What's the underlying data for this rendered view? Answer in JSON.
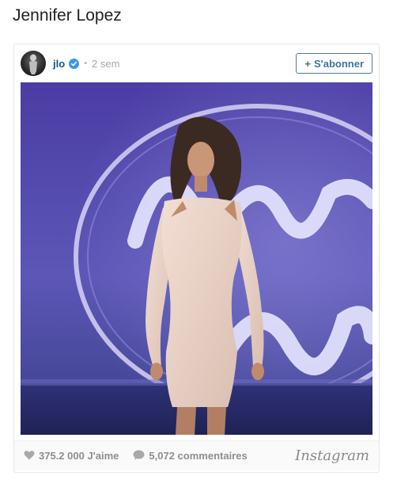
{
  "page": {
    "title": "Jennifer Lopez"
  },
  "post": {
    "username": "jlo",
    "separator": "•",
    "time": "2 sem",
    "follow_label": "S'abonner",
    "follow_plus": "+"
  },
  "footer": {
    "likes": "375.2 000 J'aime",
    "comments": "5,072 commentaires",
    "brand": "Instagram"
  },
  "colors": {
    "username": "#125688",
    "verified": "#3897f0",
    "follow_border": "#4e7ba5",
    "muted": "#8e8e8e"
  },
  "icons": {
    "verified": "verified-badge-icon",
    "heart": "heart-icon",
    "comment": "comment-icon",
    "plus": "plus-icon"
  }
}
